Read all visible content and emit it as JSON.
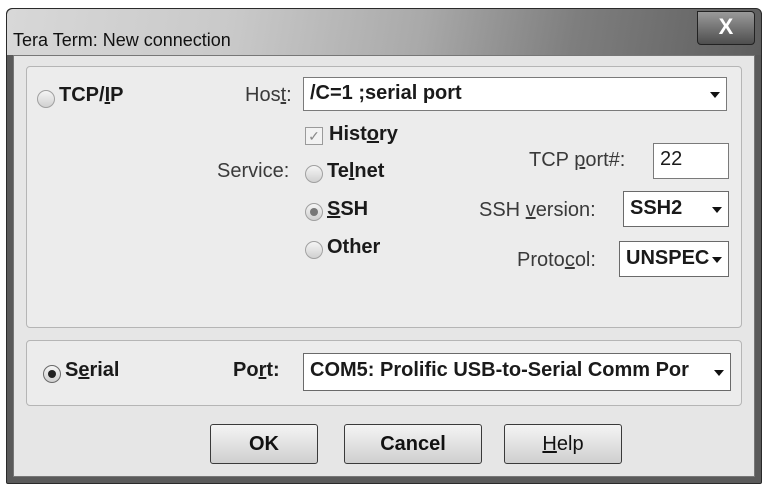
{
  "window": {
    "title": "Tera Term: New connection",
    "close_label": "X"
  },
  "tcpip": {
    "label_pre": "TCP/",
    "label_ul": "I",
    "label_post": "P",
    "host_label_pre": "Hos",
    "host_label_ul": "t",
    "host_label_post": ":",
    "host_value": "/C=1 ;serial port",
    "history_label_pre": "Hist",
    "history_label_ul": "o",
    "history_label_post": "ry",
    "history_check_mark": "✓",
    "service_label": "Service:",
    "telnet_pre": "Te",
    "telnet_ul": "l",
    "telnet_post": "net",
    "ssh_ul": "S",
    "ssh_post": "SH",
    "other_label": "Other",
    "tcp_port_label_pre": "TCP ",
    "tcp_port_label_ul": "p",
    "tcp_port_label_post": "ort#:",
    "tcp_port_value": "22",
    "ssh_version_label_pre": "SSH ",
    "ssh_version_label_ul": "v",
    "ssh_version_label_post": "ersion:",
    "ssh_version_value": "SSH2",
    "protocol_label_pre": "Proto",
    "protocol_label_ul": "c",
    "protocol_label_post": "ol:",
    "protocol_value": "UNSPEC"
  },
  "serial": {
    "label_pre": "S",
    "label_ul": "e",
    "label_post": "rial",
    "port_label_pre": "Po",
    "port_label_ul": "r",
    "port_label_post": "t:",
    "port_value": "COM5: Prolific USB-to-Serial Comm Por"
  },
  "buttons": {
    "ok": "OK",
    "cancel": "Cancel",
    "help_ul": "H",
    "help_post": "elp"
  }
}
